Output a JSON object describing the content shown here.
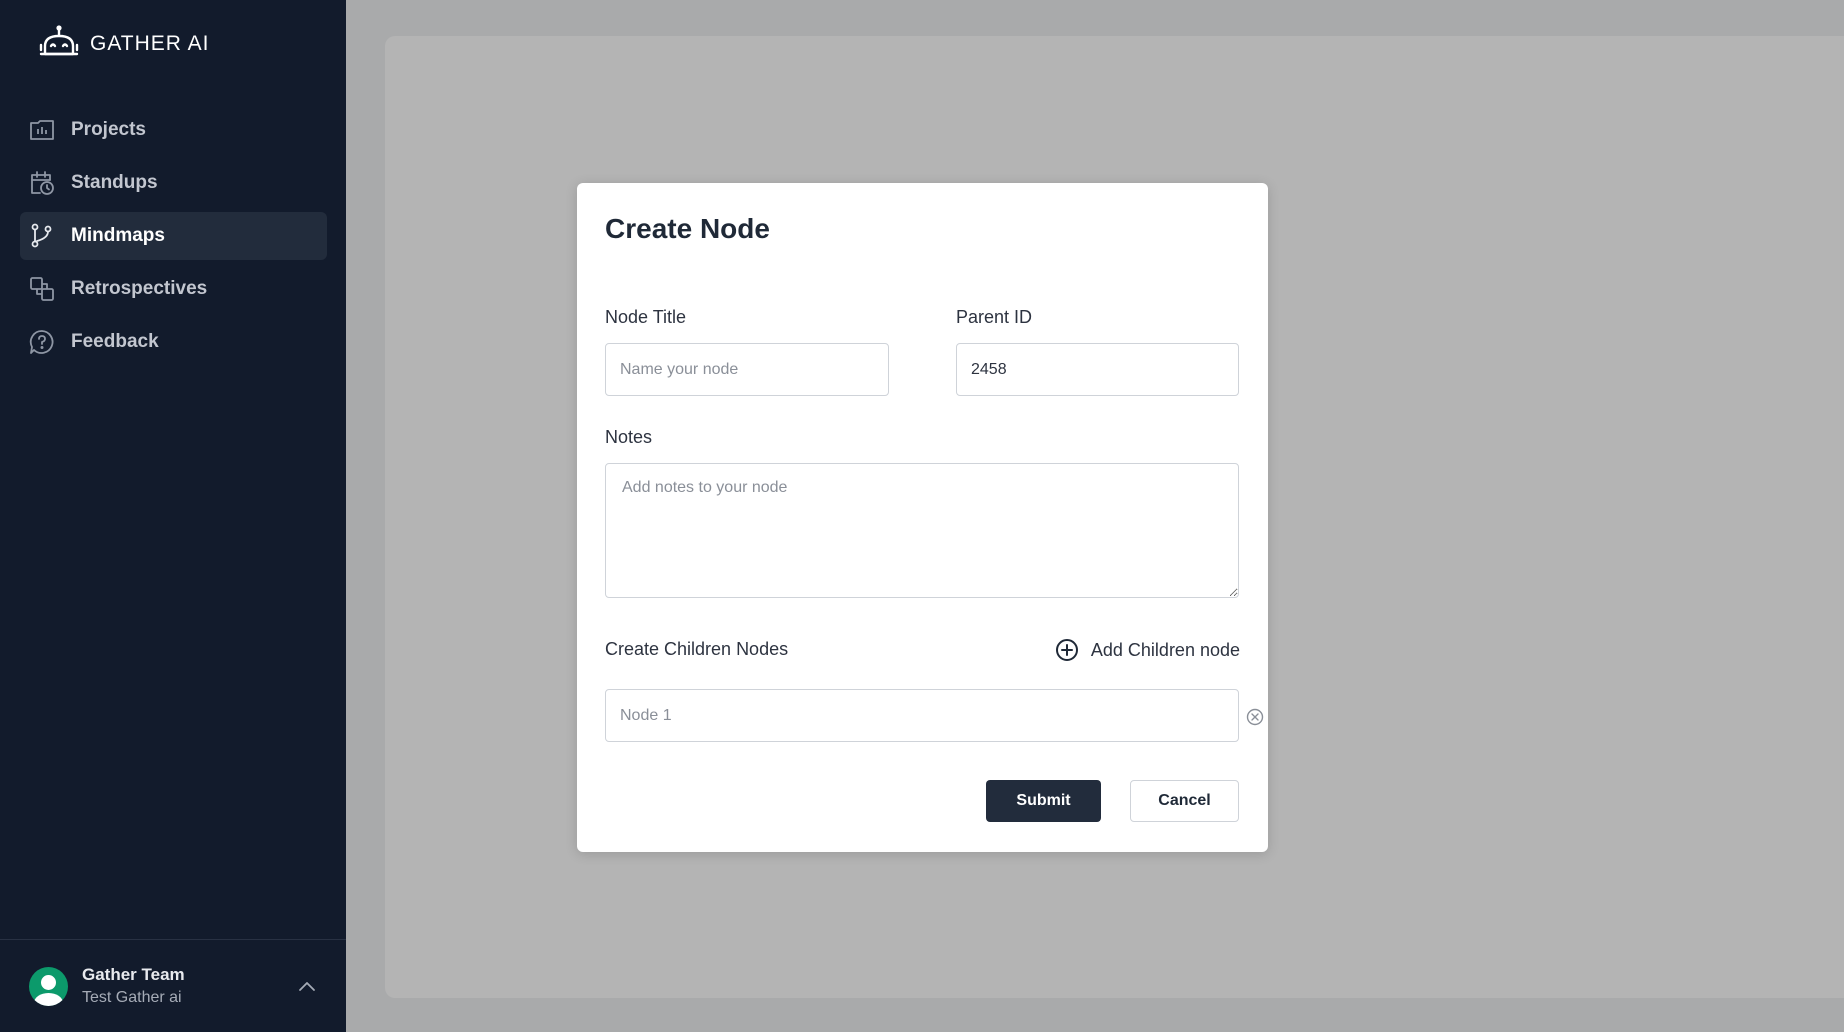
{
  "app": {
    "logo_text": "GATHER AI",
    "logo_icon": "robot-icon"
  },
  "sidebar": {
    "items": [
      {
        "label": "Projects",
        "icon": "projects-icon"
      },
      {
        "label": "Standups",
        "icon": "calendar-clock-icon"
      },
      {
        "label": "Mindmaps",
        "icon": "git-branch-icon",
        "active": true
      },
      {
        "label": "Retrospectives",
        "icon": "retrospectives-icon"
      },
      {
        "label": "Feedback",
        "icon": "feedback-icon"
      }
    ],
    "user": {
      "name": "Gather Team",
      "org": "Test Gather ai",
      "icon": "chevron-up-icon"
    }
  },
  "modal": {
    "title": "Create Node",
    "node_title": {
      "label": "Node Title",
      "placeholder": "Name your node",
      "value": ""
    },
    "parent_id": {
      "label": "Parent ID",
      "value": "2458"
    },
    "notes": {
      "label": "Notes",
      "placeholder": "Add notes to your node",
      "value": ""
    },
    "children": {
      "label": "Create Children Nodes",
      "add_label": "Add Children node",
      "items": [
        {
          "placeholder": "Node 1"
        }
      ]
    },
    "submit_label": "Submit",
    "cancel_label": "Cancel"
  },
  "colors": {
    "sidebar_bg": "#121b2c",
    "active_item_bg": "#222c3c",
    "primary_button": "#222c3c",
    "avatar_bg": "#0c9a6b",
    "overlay_bg": "#a9aaab"
  }
}
